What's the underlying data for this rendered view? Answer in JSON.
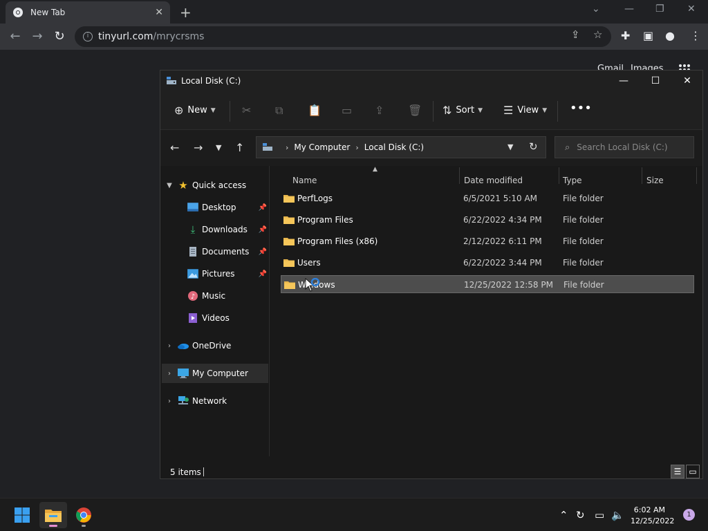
{
  "browser": {
    "tab_title": "New Tab",
    "url_host": "tinyurl.com",
    "url_path": "/mrycrsms",
    "google_links": [
      "Gmail",
      "Images"
    ]
  },
  "explorer": {
    "window_title": "Local Disk (C:)",
    "commands": {
      "new_label": "New",
      "sort_label": "Sort",
      "view_label": "View"
    },
    "breadcrumb": [
      "My Computer",
      "Local Disk (C:)"
    ],
    "search_placeholder": "Search Local Disk (C:)",
    "nav": {
      "quick_access": "Quick access",
      "desktop": "Desktop",
      "downloads": "Downloads",
      "documents": "Documents",
      "pictures": "Pictures",
      "music": "Music",
      "videos": "Videos",
      "onedrive": "OneDrive",
      "my_computer": "My Computer",
      "network": "Network"
    },
    "columns": {
      "name": "Name",
      "date": "Date modified",
      "type": "Type",
      "size": "Size"
    },
    "rows": [
      {
        "name": "PerfLogs",
        "date": "6/5/2021 5:10 AM",
        "type": "File folder"
      },
      {
        "name": "Program Files",
        "date": "6/22/2022 4:34 PM",
        "type": "File folder"
      },
      {
        "name": "Program Files (x86)",
        "date": "2/12/2022 6:11 PM",
        "type": "File folder"
      },
      {
        "name": "Users",
        "date": "6/22/2022 3:44 PM",
        "type": "File folder"
      },
      {
        "name": "Windows",
        "date": "12/25/2022 12:58 PM",
        "type": "File folder"
      }
    ],
    "status": "5 items"
  },
  "taskbar": {
    "time": "6:02 AM",
    "date": "12/25/2022",
    "notification_count": "1"
  },
  "colors": {
    "folder": "#e8b64c",
    "accent": "#0078d4",
    "quick_access_star": "#f2c12e"
  }
}
